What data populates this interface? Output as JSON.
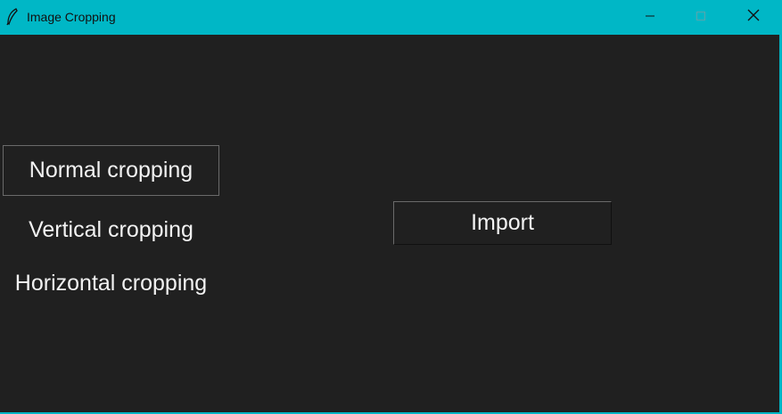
{
  "window": {
    "title": "Image Cropping",
    "controls": {
      "minimize_icon": "minimize-icon",
      "maximize_icon": "maximize-icon",
      "close_icon": "close-icon"
    },
    "colors": {
      "titlebar": "#00b7c6",
      "client_background": "#202020",
      "text": "#f2f2f2"
    }
  },
  "options": {
    "normal": "Normal cropping",
    "vertical": "Vertical cropping",
    "horizontal": "Horizontal cropping"
  },
  "actions": {
    "import_label": "Import"
  }
}
